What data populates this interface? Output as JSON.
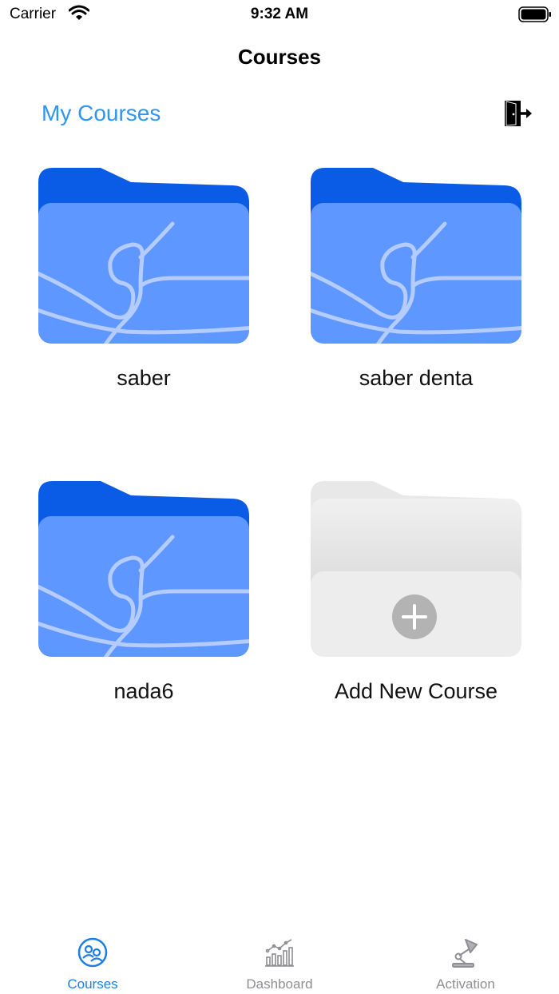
{
  "status_bar": {
    "carrier": "Carrier",
    "time": "9:32 AM"
  },
  "nav": {
    "title": "Courses"
  },
  "section": {
    "title": "My Courses",
    "logout_icon": "logout-door-icon"
  },
  "courses": [
    {
      "label": "saber",
      "icon": "folder-icon"
    },
    {
      "label": "saber denta",
      "icon": "folder-icon"
    },
    {
      "label": "nada6",
      "icon": "folder-icon"
    }
  ],
  "add_course": {
    "label": "Add New Course",
    "icon": "plus-icon"
  },
  "tabbar": {
    "items": [
      {
        "label": "Courses",
        "icon": "people-circle-icon",
        "active": true
      },
      {
        "label": "Dashboard",
        "icon": "chart-icon",
        "active": false
      },
      {
        "label": "Activation",
        "icon": "desk-lamp-icon",
        "active": false
      }
    ]
  },
  "colors": {
    "accent": "#2f96f0",
    "tab_active": "#1c7ee3",
    "tab_inactive": "#8e8e93",
    "folder_back": "#0a5ce6",
    "folder_front": "#5e97ff",
    "folder_lines": "#b4ccff",
    "add_folder_back": "#e8e8e8",
    "add_folder_front": "#ededed",
    "plus_circle": "#b3b3b3"
  }
}
